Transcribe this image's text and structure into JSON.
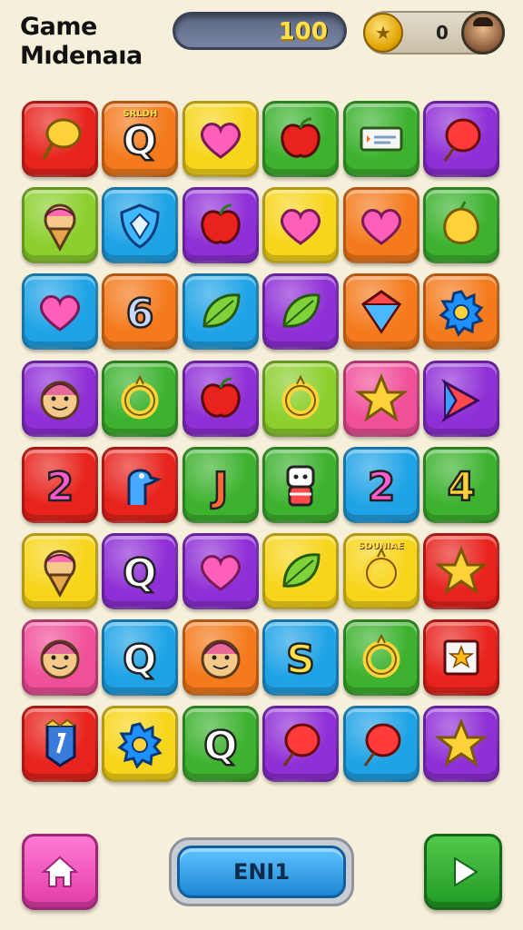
{
  "header": {
    "title_line1": "Game",
    "title_line2": "Mıdenaıa",
    "score": "100",
    "coin_count": "0"
  },
  "colors": {
    "red": "#e8231d",
    "orange": "#f47a1c",
    "yellow": "#f7d51a",
    "green": "#3db22f",
    "purple": "#8f2fd6",
    "blue": "#1fa3e6",
    "pink": "#f0509a",
    "lime": "#8ccf2e"
  },
  "tiles": [
    {
      "color": "red",
      "icon": "lollipop-icon"
    },
    {
      "color": "orange",
      "icon": "letter-q-icon",
      "text": "Q",
      "badge": "SRLDH"
    },
    {
      "color": "yellow",
      "icon": "heart-icon"
    },
    {
      "color": "green",
      "icon": "apple-icon"
    },
    {
      "color": "green",
      "icon": "card-icon"
    },
    {
      "color": "purple",
      "icon": "balloon-icon"
    },
    {
      "color": "lime",
      "icon": "ice-cream-icon"
    },
    {
      "color": "blue",
      "icon": "shield-icon"
    },
    {
      "color": "purple",
      "icon": "apple-icon"
    },
    {
      "color": "yellow",
      "icon": "heart-icon"
    },
    {
      "color": "orange",
      "icon": "heart-icon"
    },
    {
      "color": "green",
      "icon": "lemon-icon"
    },
    {
      "color": "blue",
      "icon": "heart-icon"
    },
    {
      "color": "orange",
      "icon": "letter-6-icon",
      "text": "6"
    },
    {
      "color": "blue",
      "icon": "leaf-icon"
    },
    {
      "color": "purple",
      "icon": "leaf-icon"
    },
    {
      "color": "orange",
      "icon": "gem-icon"
    },
    {
      "color": "orange",
      "icon": "gear-icon"
    },
    {
      "color": "purple",
      "icon": "face-icon"
    },
    {
      "color": "green",
      "icon": "ring-icon"
    },
    {
      "color": "purple",
      "icon": "apple-icon"
    },
    {
      "color": "lime",
      "icon": "ring-icon"
    },
    {
      "color": "pink",
      "icon": "star-icon"
    },
    {
      "color": "purple",
      "icon": "arrow-icon"
    },
    {
      "color": "red",
      "icon": "number-2-icon",
      "text": "2"
    },
    {
      "color": "red",
      "icon": "bird-icon"
    },
    {
      "color": "green",
      "icon": "letter-j-icon",
      "text": "J"
    },
    {
      "color": "green",
      "icon": "robot-icon"
    },
    {
      "color": "blue",
      "icon": "number-2-icon",
      "text": "2"
    },
    {
      "color": "green",
      "icon": "number-4-icon",
      "text": "4"
    },
    {
      "color": "yellow",
      "icon": "ice-cream-icon"
    },
    {
      "color": "purple",
      "icon": "letter-q-icon",
      "text": "Q"
    },
    {
      "color": "purple",
      "icon": "heart-icon"
    },
    {
      "color": "yellow",
      "icon": "leaf-icon"
    },
    {
      "color": "yellow",
      "icon": "ring-icon",
      "badge": "SDUNIAE"
    },
    {
      "color": "red",
      "icon": "star-icon"
    },
    {
      "color": "pink",
      "icon": "face-icon"
    },
    {
      "color": "blue",
      "icon": "letter-q-icon",
      "text": "Q"
    },
    {
      "color": "orange",
      "icon": "face-icon"
    },
    {
      "color": "blue",
      "icon": "letter-s-icon",
      "text": "S"
    },
    {
      "color": "green",
      "icon": "ring-icon"
    },
    {
      "color": "red",
      "icon": "card-star-icon"
    },
    {
      "color": "red",
      "icon": "flag-icon"
    },
    {
      "color": "yellow",
      "icon": "gear-icon"
    },
    {
      "color": "green",
      "icon": "letter-q-icon",
      "text": "Q"
    },
    {
      "color": "purple",
      "icon": "balloon-icon"
    },
    {
      "color": "blue",
      "icon": "balloon-icon"
    },
    {
      "color": "purple",
      "icon": "star-icon"
    }
  ],
  "footer": {
    "home_icon": "home-icon",
    "main_button_label": "ENI1",
    "play_icon": "play-icon"
  }
}
